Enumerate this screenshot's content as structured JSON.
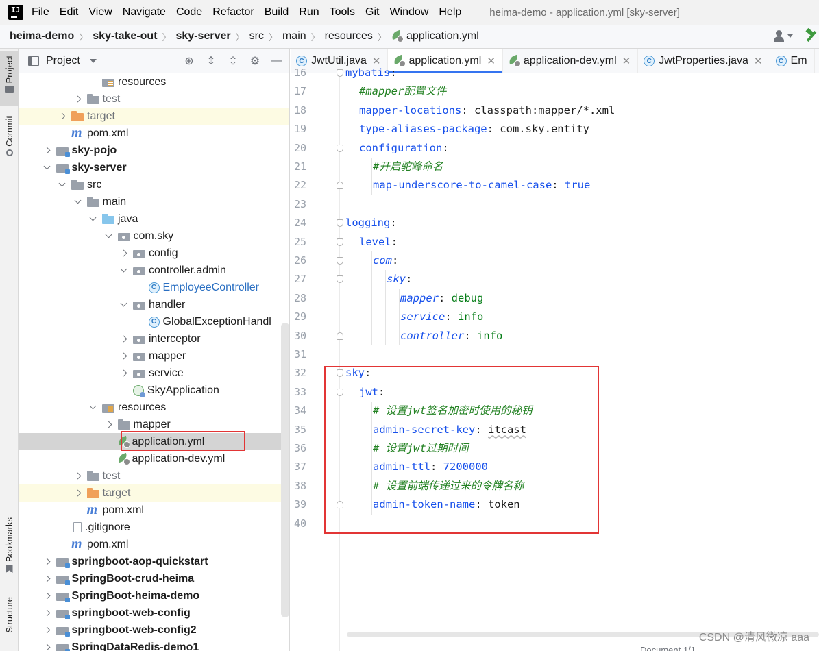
{
  "menu": {
    "items": [
      {
        "mnemonic": "F",
        "rest": "ile"
      },
      {
        "mnemonic": "E",
        "rest": "dit"
      },
      {
        "mnemonic": "V",
        "rest": "iew"
      },
      {
        "mnemonic": "N",
        "rest": "avigate"
      },
      {
        "mnemonic": "C",
        "rest": "ode"
      },
      {
        "mnemonic": "R",
        "rest": "efactor"
      },
      {
        "mnemonic": "B",
        "rest": "uild"
      },
      {
        "mnemonic": "R",
        "rest": "un"
      },
      {
        "mnemonic": "T",
        "rest": "ools"
      },
      {
        "mnemonic": "G",
        "rest": "it"
      },
      {
        "mnemonic": "W",
        "rest": "indow"
      },
      {
        "mnemonic": "H",
        "rest": "elp"
      }
    ],
    "window_title": "heima-demo - application.yml [sky-server]"
  },
  "breadcrumb": [
    "heima-demo",
    "sky-take-out",
    "sky-server",
    "src",
    "main",
    "resources",
    "application.yml"
  ],
  "left_strip": {
    "project": "Project",
    "commit": "Commit",
    "bookmarks": "Bookmarks",
    "structure": "Structure"
  },
  "project_panel": {
    "title": "Project",
    "tree": [
      {
        "label": "resources",
        "icon": "resources",
        "arrow": "",
        "indent": 4,
        "style": ""
      },
      {
        "label": "test",
        "icon": "folder",
        "arrow": "right",
        "indent": 3,
        "style": ""
      },
      {
        "label": "target",
        "icon": "folder-orange",
        "arrow": "right",
        "indent": 2,
        "style": "excl"
      },
      {
        "label": "pom.xml",
        "icon": "maven",
        "arrow": "",
        "indent": 2,
        "style": ""
      },
      {
        "label": "sky-pojo",
        "icon": "module",
        "arrow": "right",
        "indent": 1,
        "style": "bold"
      },
      {
        "label": "sky-server",
        "icon": "module",
        "arrow": "down",
        "indent": 1,
        "style": "bold"
      },
      {
        "label": "src",
        "icon": "folder",
        "arrow": "down",
        "indent": 2,
        "style": ""
      },
      {
        "label": "main",
        "icon": "folder",
        "arrow": "down",
        "indent": 3,
        "style": ""
      },
      {
        "label": "java",
        "icon": "folder-blue",
        "arrow": "down",
        "indent": 4,
        "style": ""
      },
      {
        "label": "com.sky",
        "icon": "package",
        "arrow": "down",
        "indent": 5,
        "style": ""
      },
      {
        "label": "config",
        "icon": "package",
        "arrow": "right",
        "indent": 6,
        "style": ""
      },
      {
        "label": "controller.admin",
        "icon": "package",
        "arrow": "down",
        "indent": 6,
        "style": ""
      },
      {
        "label": "EmployeeController",
        "icon": "class",
        "arrow": "",
        "indent": 7,
        "style": "blue"
      },
      {
        "label": "handler",
        "icon": "package",
        "arrow": "down",
        "indent": 6,
        "style": ""
      },
      {
        "label": "GlobalExceptionHandl",
        "icon": "class",
        "arrow": "",
        "indent": 7,
        "style": ""
      },
      {
        "label": "interceptor",
        "icon": "package",
        "arrow": "right",
        "indent": 6,
        "style": ""
      },
      {
        "label": "mapper",
        "icon": "package",
        "arrow": "right",
        "indent": 6,
        "style": ""
      },
      {
        "label": "service",
        "icon": "package",
        "arrow": "right",
        "indent": 6,
        "style": ""
      },
      {
        "label": "SkyApplication",
        "icon": "spring",
        "arrow": "",
        "indent": 6,
        "style": ""
      },
      {
        "label": "resources",
        "icon": "resources",
        "arrow": "down",
        "indent": 4,
        "style": ""
      },
      {
        "label": "mapper",
        "icon": "folder",
        "arrow": "right",
        "indent": 5,
        "style": ""
      },
      {
        "label": "application.yml",
        "icon": "yml",
        "arrow": "",
        "indent": 5,
        "style": "sel"
      },
      {
        "label": "application-dev.yml",
        "icon": "yml",
        "arrow": "",
        "indent": 5,
        "style": ""
      },
      {
        "label": "test",
        "icon": "folder",
        "arrow": "right",
        "indent": 3,
        "style": ""
      },
      {
        "label": "target",
        "icon": "folder-orange",
        "arrow": "right",
        "indent": 3,
        "style": "excl"
      },
      {
        "label": "pom.xml",
        "icon": "maven",
        "arrow": "",
        "indent": 3,
        "style": ""
      },
      {
        "label": ".gitignore",
        "icon": "file",
        "arrow": "",
        "indent": 2,
        "style": ""
      },
      {
        "label": "pom.xml",
        "icon": "maven",
        "arrow": "",
        "indent": 2,
        "style": ""
      },
      {
        "label": "springboot-aop-quickstart",
        "icon": "module",
        "arrow": "right",
        "indent": 1,
        "style": "bold"
      },
      {
        "label": "SpringBoot-crud-heima",
        "icon": "module",
        "arrow": "right",
        "indent": 1,
        "style": "bold"
      },
      {
        "label": "SpringBoot-heima-demo",
        "icon": "module",
        "arrow": "right",
        "indent": 1,
        "style": "bold"
      },
      {
        "label": "springboot-web-config",
        "icon": "module",
        "arrow": "right",
        "indent": 1,
        "style": "bold"
      },
      {
        "label": "springboot-web-config2",
        "icon": "module",
        "arrow": "right",
        "indent": 1,
        "style": "bold"
      },
      {
        "label": "SpringDataRedis-demo1",
        "icon": "module",
        "arrow": "right",
        "indent": 1,
        "style": "bold"
      }
    ]
  },
  "editor": {
    "tabs": [
      {
        "label": "JwtUtil.java",
        "icon": "class",
        "active": false,
        "close": true
      },
      {
        "label": "application.yml",
        "icon": "yml",
        "active": true,
        "close": true
      },
      {
        "label": "application-dev.yml",
        "icon": "yml",
        "active": false,
        "close": true
      },
      {
        "label": "JwtProperties.java",
        "icon": "class",
        "active": false,
        "close": true
      },
      {
        "label": "Em",
        "icon": "class",
        "active": false,
        "close": false
      }
    ],
    "lines": [
      {
        "n": "16",
        "indent": 0,
        "fold": "start",
        "parts": [
          {
            "t": "mybatis",
            "c": "k"
          },
          {
            "t": ":",
            "c": "vp"
          }
        ]
      },
      {
        "n": "17",
        "indent": 1,
        "fold": "",
        "parts": [
          {
            "t": "#mapper配置文件",
            "c": "c"
          }
        ]
      },
      {
        "n": "18",
        "indent": 1,
        "fold": "",
        "parts": [
          {
            "t": "mapper-locations",
            "c": "k"
          },
          {
            "t": ": classpath:mapper/*.xml",
            "c": "vp"
          }
        ]
      },
      {
        "n": "19",
        "indent": 1,
        "fold": "",
        "parts": [
          {
            "t": "type-aliases-package",
            "c": "k"
          },
          {
            "t": ": com.sky.entity",
            "c": "vp"
          }
        ]
      },
      {
        "n": "20",
        "indent": 1,
        "fold": "start",
        "parts": [
          {
            "t": "configuration",
            "c": "k"
          },
          {
            "t": ":",
            "c": "vp"
          }
        ]
      },
      {
        "n": "21",
        "indent": 2,
        "fold": "",
        "parts": [
          {
            "t": "#开启驼峰命名",
            "c": "c"
          }
        ]
      },
      {
        "n": "22",
        "indent": 2,
        "fold": "end",
        "parts": [
          {
            "t": "map-underscore-to-camel-case",
            "c": "k"
          },
          {
            "t": ": ",
            "c": "vp"
          },
          {
            "t": "true",
            "c": "vb"
          }
        ]
      },
      {
        "n": "23",
        "indent": 0,
        "fold": "",
        "parts": []
      },
      {
        "n": "24",
        "indent": 0,
        "fold": "start",
        "parts": [
          {
            "t": "logging",
            "c": "k"
          },
          {
            "t": ":",
            "c": "vp"
          }
        ]
      },
      {
        "n": "25",
        "indent": 1,
        "fold": "start",
        "parts": [
          {
            "t": "level",
            "c": "k"
          },
          {
            "t": ":",
            "c": "vp"
          }
        ]
      },
      {
        "n": "26",
        "indent": 2,
        "fold": "start",
        "parts": [
          {
            "t": "com",
            "c": "ki"
          },
          {
            "t": ":",
            "c": "vp"
          }
        ]
      },
      {
        "n": "27",
        "indent": 3,
        "fold": "start",
        "parts": [
          {
            "t": "sky",
            "c": "ki"
          },
          {
            "t": ":",
            "c": "vp"
          }
        ]
      },
      {
        "n": "28",
        "indent": 4,
        "fold": "",
        "parts": [
          {
            "t": "mapper",
            "c": "ki"
          },
          {
            "t": ": ",
            "c": "vp"
          },
          {
            "t": "debug",
            "c": "v"
          }
        ]
      },
      {
        "n": "29",
        "indent": 4,
        "fold": "",
        "parts": [
          {
            "t": "service",
            "c": "ki"
          },
          {
            "t": ": ",
            "c": "vp"
          },
          {
            "t": "info",
            "c": "v"
          }
        ]
      },
      {
        "n": "30",
        "indent": 4,
        "fold": "end",
        "parts": [
          {
            "t": "controller",
            "c": "ki"
          },
          {
            "t": ": ",
            "c": "vp"
          },
          {
            "t": "info",
            "c": "v"
          }
        ]
      },
      {
        "n": "31",
        "indent": 0,
        "fold": "",
        "parts": []
      },
      {
        "n": "32",
        "indent": 0,
        "fold": "start",
        "parts": [
          {
            "t": "sky",
            "c": "k"
          },
          {
            "t": ":",
            "c": "vp"
          }
        ]
      },
      {
        "n": "33",
        "indent": 1,
        "fold": "start",
        "parts": [
          {
            "t": "jwt",
            "c": "k"
          },
          {
            "t": ":",
            "c": "vp"
          }
        ]
      },
      {
        "n": "34",
        "indent": 2,
        "fold": "",
        "parts": [
          {
            "t": "# 设置jwt签名加密时使用的秘钥",
            "c": "c"
          }
        ]
      },
      {
        "n": "35",
        "indent": 2,
        "fold": "",
        "parts": [
          {
            "t": "admin-secret-key",
            "c": "k"
          },
          {
            "t": ": ",
            "c": "vp"
          },
          {
            "t": "itcast",
            "c": "vp squiggle"
          }
        ]
      },
      {
        "n": "36",
        "indent": 2,
        "fold": "",
        "parts": [
          {
            "t": "# 设置jwt过期时间",
            "c": "c"
          }
        ]
      },
      {
        "n": "37",
        "indent": 2,
        "fold": "",
        "parts": [
          {
            "t": "admin-ttl",
            "c": "k"
          },
          {
            "t": ": ",
            "c": "vp"
          },
          {
            "t": "7200000",
            "c": "vb"
          }
        ]
      },
      {
        "n": "38",
        "indent": 2,
        "fold": "",
        "parts": [
          {
            "t": "# 设置前端传递过来的令牌名称",
            "c": "c"
          }
        ]
      },
      {
        "n": "39",
        "indent": 2,
        "fold": "end",
        "parts": [
          {
            "t": "admin-token-name",
            "c": "k"
          },
          {
            "t": ": token",
            "c": "vp"
          }
        ]
      },
      {
        "n": "40",
        "indent": 0,
        "fold": "",
        "parts": []
      }
    ],
    "status_peek": "Document 1/1"
  },
  "watermark": "CSDN @清风微凉 aaa",
  "colors": {
    "accent": "#3574f0",
    "highlight_box": "#e23535",
    "key": "#1750eb",
    "comment": "#238223",
    "value_green": "#067d17"
  }
}
